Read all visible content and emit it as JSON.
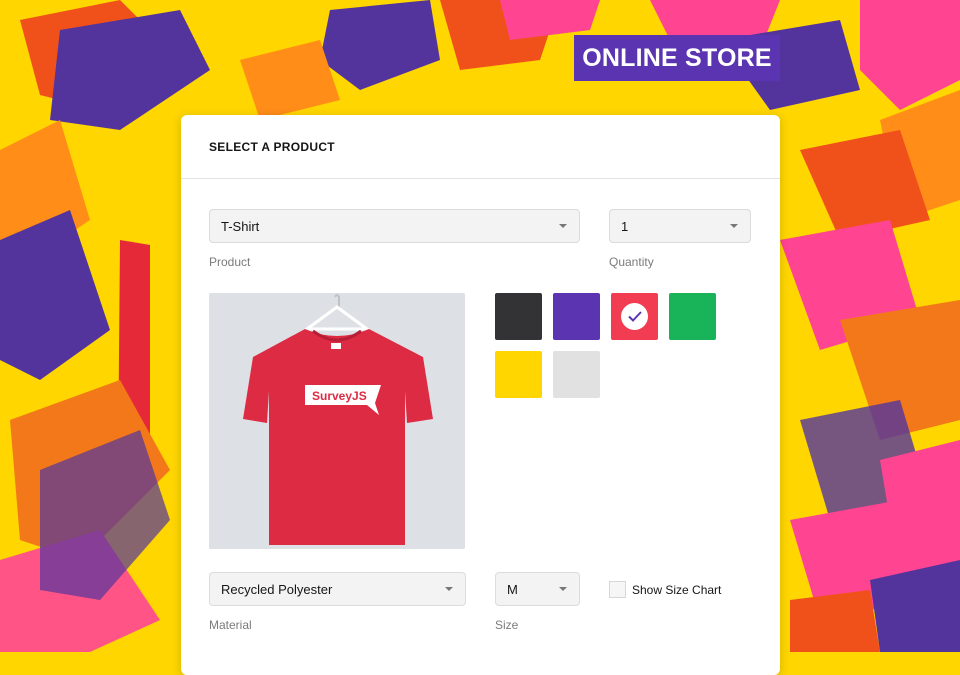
{
  "banner": {
    "title": "ONLINE STORE"
  },
  "card": {
    "title": "SELECT A PRODUCT"
  },
  "product": {
    "value": "T-Shirt",
    "label": "Product"
  },
  "quantity": {
    "value": "1",
    "label": "Quantity"
  },
  "image": {
    "logo_text": "SurveyJS",
    "shirt_color": "#dd2b44"
  },
  "colors": {
    "swatches": [
      {
        "name": "black",
        "hex": "#333336"
      },
      {
        "name": "purple",
        "hex": "#5b35b1"
      },
      {
        "name": "red",
        "hex": "#f23c52",
        "selected": true
      },
      {
        "name": "green",
        "hex": "#19b35a"
      },
      {
        "name": "yellow",
        "hex": "#ffd600"
      },
      {
        "name": "light-gray",
        "hex": "#e1e1e1"
      }
    ],
    "accent": "#5b35b1"
  },
  "material": {
    "value": "Recycled Polyester",
    "label": "Material"
  },
  "size": {
    "value": "M",
    "label": "Size"
  },
  "size_chart": {
    "label": "Show Size Chart",
    "checked": false
  }
}
